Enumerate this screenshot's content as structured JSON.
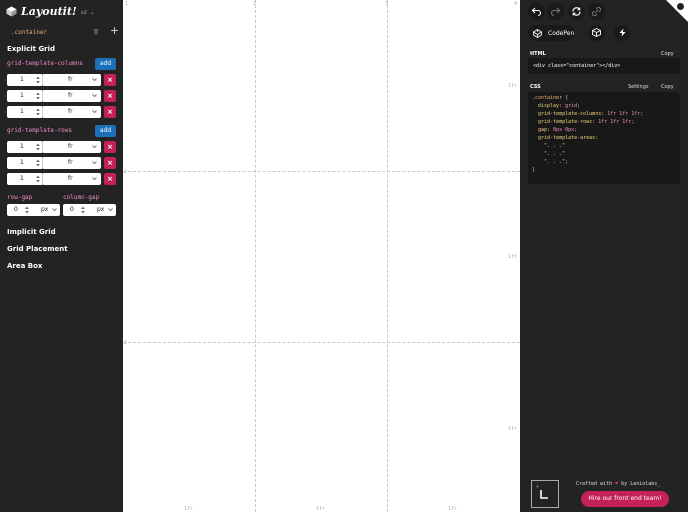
{
  "app": {
    "title": "Layoutit!",
    "version": "v2",
    "selected_container": ".container"
  },
  "sidebar": {
    "explicit_grid_title": "Explicit Grid",
    "columns_label": "grid-template-columns",
    "rows_label": "grid-template-rows",
    "add_label": "add",
    "delete_label": "×",
    "columns": [
      {
        "value": "1",
        "unit": "fr"
      },
      {
        "value": "1",
        "unit": "fr"
      },
      {
        "value": "1",
        "unit": "fr"
      }
    ],
    "rows": [
      {
        "value": "1",
        "unit": "fr"
      },
      {
        "value": "1",
        "unit": "fr"
      },
      {
        "value": "1",
        "unit": "fr"
      }
    ],
    "row_gap_label": "row-gap",
    "column_gap_label": "column-gap",
    "row_gap": {
      "value": "0",
      "unit": "px"
    },
    "column_gap": {
      "value": "0",
      "unit": "px"
    },
    "sections": [
      "Implicit Grid",
      "Grid Placement",
      "Area Box"
    ]
  },
  "canvas": {
    "col_ticks": [
      "1",
      "2",
      "3",
      "4"
    ],
    "row_ticks": [
      "1",
      "2",
      "3"
    ],
    "col_fr_labels": [
      "1fr",
      "1fr",
      "1fr"
    ],
    "row_fr_labels": [
      "1fr",
      "1fr",
      "1fr"
    ]
  },
  "right_panel": {
    "codepen_label": "CodePen",
    "html_heading": "HTML",
    "copy_label": "Copy",
    "html_code": "<div class=\"container\"></div>",
    "css_heading": "CSS",
    "settings_label": "Settings",
    "css_lines": {
      "open": ".container {",
      "display_prop": "display:",
      "display_val": "grid;",
      "cols_prop": "grid-template-columns:",
      "cols_val": "1fr 1fr 1fr;",
      "rows_prop": "grid-template-rows:",
      "rows_val": "1fr 1fr 1fr;",
      "gap_prop": "gap:",
      "gap_val": "0px 0px;",
      "areas_prop": "grid-template-areas:",
      "areas_1": "\". . .\"",
      "areas_2": "\". . .\"",
      "areas_3": "\". . .\";",
      "close": "}"
    },
    "crafted_prefix": "Crafted with",
    "crafted_heart": "♥",
    "crafted_suffix": "by Leniolabs_",
    "hire_label": "Hire our front end team!"
  },
  "colors": {
    "sidebar_bg": "#232323",
    "accent_blue": "#1d6fb8",
    "accent_pink": "#c4215a",
    "prop_pink": "#f08ec8",
    "selector_orange": "#e8b07b"
  }
}
